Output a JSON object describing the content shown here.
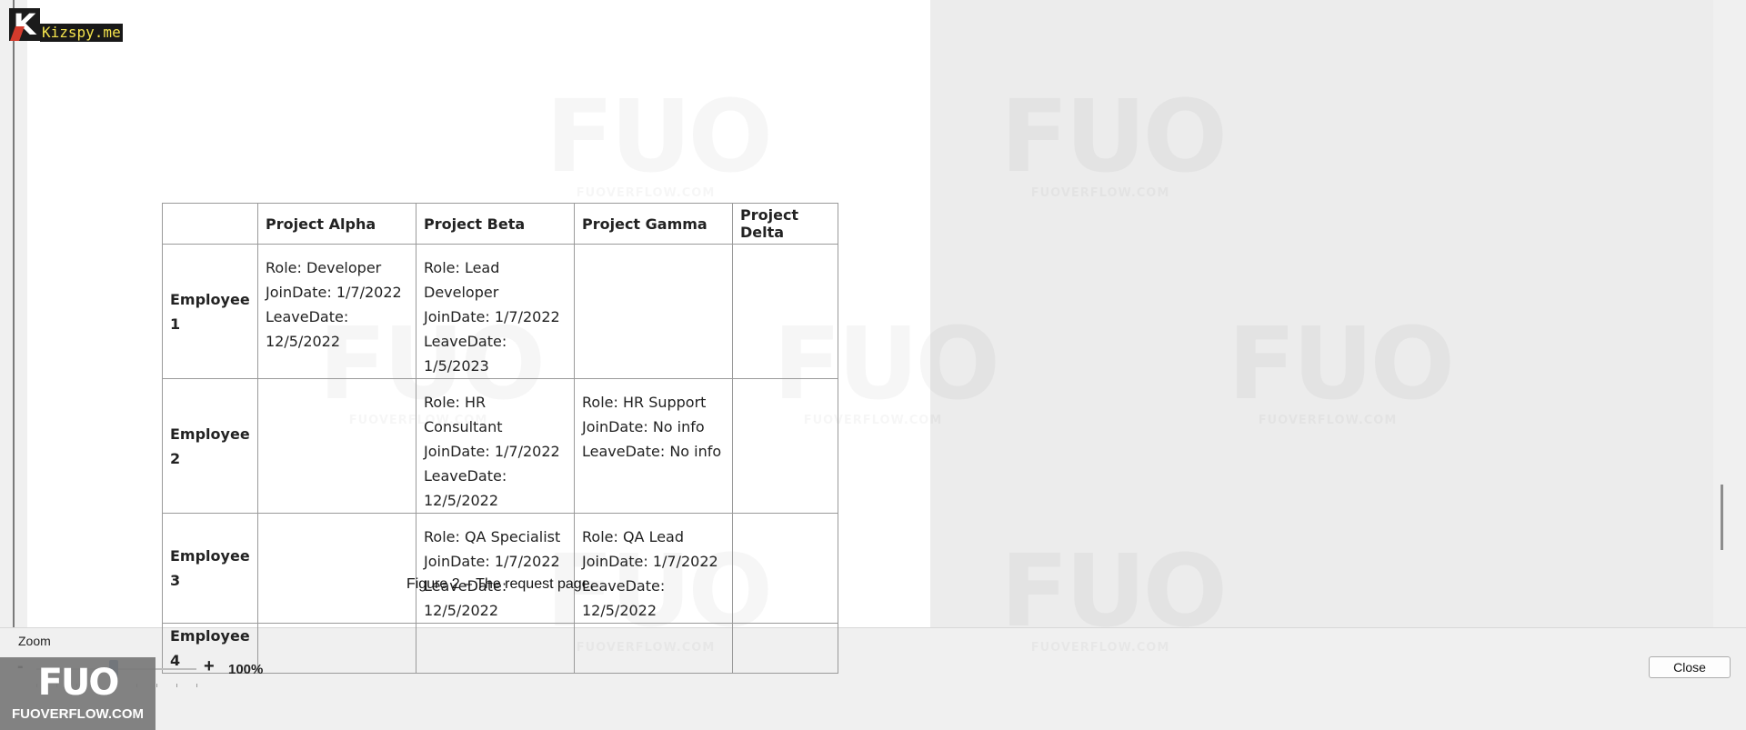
{
  "site_logo": {
    "letter": "K",
    "text": "Kizspy.me"
  },
  "watermark": {
    "big": "FUO",
    "small": "FUOVERFLOW.COM"
  },
  "document": {
    "table": {
      "headers": [
        "",
        "Project Alpha",
        "Project Beta",
        "Project Gamma",
        "Project Delta"
      ],
      "rows": [
        {
          "label": "Employee 1",
          "cells": [
            [
              "Role: Developer",
              "JoinDate: 1/7/2022",
              "LeaveDate: 12/5/2022"
            ],
            [
              "Role: Lead Developer",
              "JoinDate: 1/7/2022",
              "LeaveDate: 1/5/2023"
            ],
            [
              "",
              "",
              ""
            ],
            [
              "",
              "",
              ""
            ]
          ]
        },
        {
          "label": "Employee 2",
          "cells": [
            [
              "",
              "",
              ""
            ],
            [
              "Role: HR Consultant",
              "JoinDate: 1/7/2022",
              "LeaveDate: 12/5/2022"
            ],
            [
              "Role: HR Support",
              "JoinDate: No info",
              "LeaveDate: No info"
            ],
            [
              "",
              "",
              ""
            ]
          ]
        },
        {
          "label": "Employee 3",
          "cells": [
            [
              "",
              "",
              ""
            ],
            [
              "Role: QA Specialist",
              "JoinDate: 1/7/2022",
              "LeaveDate: 12/5/2022"
            ],
            [
              "Role: QA Lead",
              "JoinDate: 1/7/2022",
              "LeaveDate: 12/5/2022"
            ],
            [
              "",
              "",
              ""
            ]
          ]
        },
        {
          "label": "Employee 4",
          "cells": [
            [
              ""
            ],
            [
              ""
            ],
            [
              ""
            ],
            [
              ""
            ]
          ]
        }
      ]
    },
    "caption": "Figure 2 – The request page."
  },
  "zoom": {
    "label": "Zoom",
    "minus": "-",
    "plus": "+",
    "value_text": "100%",
    "level_fraction": 0.5
  },
  "fuo_badge": {
    "big": "FUO",
    "small": "FUOVERFLOW.COM"
  },
  "close_label": "Close",
  "colors": {
    "zoom_thumb": "#2a5f9e",
    "grid_border": "#9a9a9a"
  }
}
